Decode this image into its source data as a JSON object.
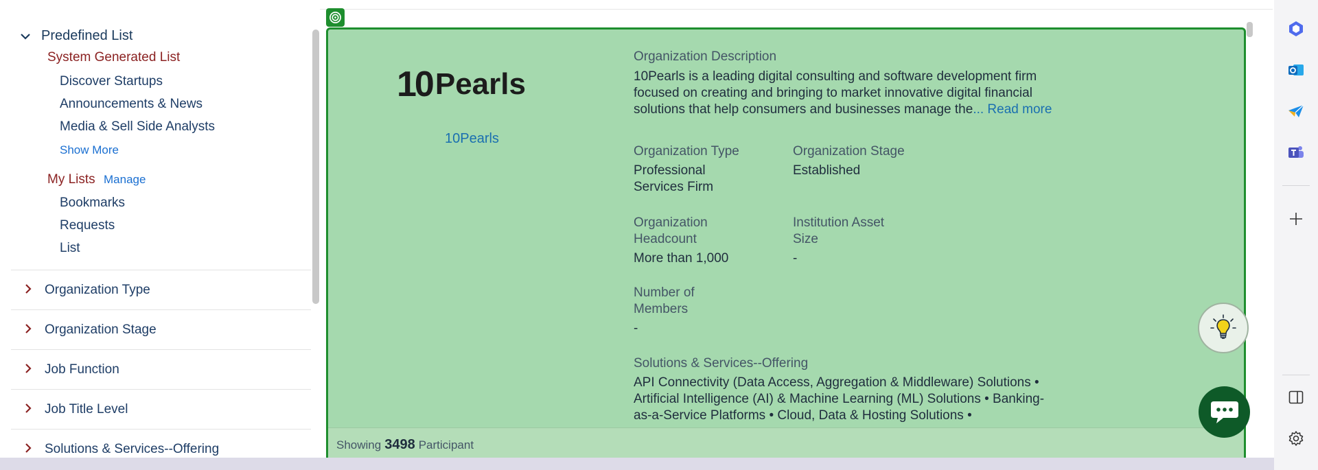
{
  "filters": {
    "section_title": "Predefined List",
    "system_group": "System Generated List",
    "system_items": [
      "Discover Startups",
      "Announcements & News",
      "Media & Sell Side Analysts"
    ],
    "show_more": "Show More",
    "my_lists_label": "My Lists",
    "manage_label": "Manage",
    "my_list_items": [
      "Bookmarks",
      "Requests",
      "List"
    ],
    "accordions": [
      "Organization Type",
      "Organization Stage",
      "Job Function",
      "Job Title Level",
      "Solutions & Services--Offering"
    ]
  },
  "org": {
    "logo_text": "Pearls",
    "logo_mark": "10",
    "name": "10Pearls",
    "description_label": "Organization Description",
    "description": "10Pearls is a leading digital consulting and software development firm focused on creating and bringing to market innovative digital financial solutions that help consumers and businesses manage the",
    "read_more": "... Read more",
    "type_label": "Organization Type",
    "type_value": "Professional Services Firm",
    "stage_label": "Organization Stage",
    "stage_value": "Established",
    "headcount_label": "Organization Headcount",
    "headcount_value": "More than 1,000",
    "asset_label": "Institution Asset Size",
    "asset_value": "-",
    "members_label": "Number of Members",
    "members_value": "-",
    "solutions_label": "Solutions & Services--Offering",
    "solutions_value": "API Connectivity (Data Access, Aggregation & Middleware) Solutions • Artificial Intelligence (AI) & Machine Learning (ML) Solutions • Banking-as-a-Service Platforms • Cloud, Data & Hosting Solutions •"
  },
  "footer": {
    "showing": "Showing",
    "count": "3498",
    "unit": "Participant"
  },
  "colors": {
    "card_bg": "#a5d9ae",
    "card_border": "#1e8e2e",
    "chat_button": "#0e5a28",
    "link": "#1a6fb0"
  },
  "rail_icons": [
    "copilot-icon",
    "outlook-icon",
    "send-icon",
    "teams-icon",
    "add-icon",
    "sidebar-icon",
    "settings-icon"
  ]
}
